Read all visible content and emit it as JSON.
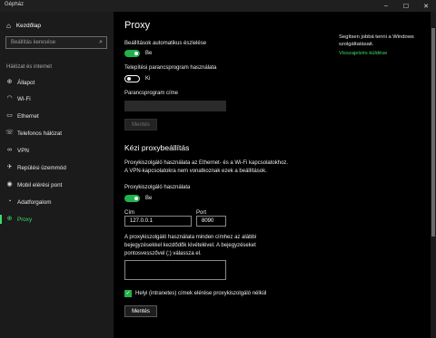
{
  "window": {
    "title": "Gépház",
    "minimize": "–",
    "maximize": "☐",
    "close": "✕"
  },
  "sidebar": {
    "home_label": "Kezdőlap",
    "search_placeholder": "Beállítás keresése",
    "section_title": "Hálózat és internet",
    "items": [
      {
        "label": "Állapot",
        "icon": "globe-icon"
      },
      {
        "label": "Wi-Fi",
        "icon": "wifi-icon"
      },
      {
        "label": "Ethernet",
        "icon": "ethernet-icon"
      },
      {
        "label": "Telefonos hálózat",
        "icon": "phone-icon"
      },
      {
        "label": "VPN",
        "icon": "vpn-icon"
      },
      {
        "label": "Repülési üzemmód",
        "icon": "airplane-icon"
      },
      {
        "label": "Mobil elérési pont",
        "icon": "hotspot-icon"
      },
      {
        "label": "Adatforgalom",
        "icon": "data-usage-icon"
      },
      {
        "label": "Proxy",
        "icon": "globe-icon",
        "active": true
      }
    ]
  },
  "main": {
    "title": "Proxy",
    "auto_detect_label": "Beállítások automatikus észlelése",
    "auto_detect_state": "Be",
    "setup_script_label": "Telepítési parancsprogram használata",
    "setup_script_state": "Ki",
    "script_address_label": "Parancsprogram címe",
    "save_label": "Mentés",
    "manual_title": "Kézi proxybeállítás",
    "manual_desc_1": "Proxykiszolgáló használata az Ethernet- és a Wi-Fi kapcsolatokhoz.",
    "manual_desc_2": "A VPN-kapcsolatokra nem vonatkoznak ezek a beállítások.",
    "use_proxy_label": "Proxykiszolgáló használata",
    "use_proxy_state": "Be",
    "address_label": "Cím",
    "address_value": "127.0.0.1",
    "port_label": "Port",
    "port_value": "8090",
    "exceptions_text_1": "A proxykiszolgáló használata minden címhez az alábbi",
    "exceptions_text_2": "bejegyzésekkel kezdődők kivételével. A bejegyzéseket",
    "exceptions_text_3": "pontosvesszővel (;) válassza el.",
    "local_bypass_label": "Helyi (intranetes) címek elérése proxykiszolgáló nélkül",
    "save_label_2": "Mentés"
  },
  "side_panel": {
    "help_text": "Segítsen jobbá tenni a Windows szolgáltatásait.",
    "feedback_link": "Visszajelzés küldése"
  },
  "colors": {
    "accent": "#22b14c",
    "link": "#3ddc6b"
  }
}
